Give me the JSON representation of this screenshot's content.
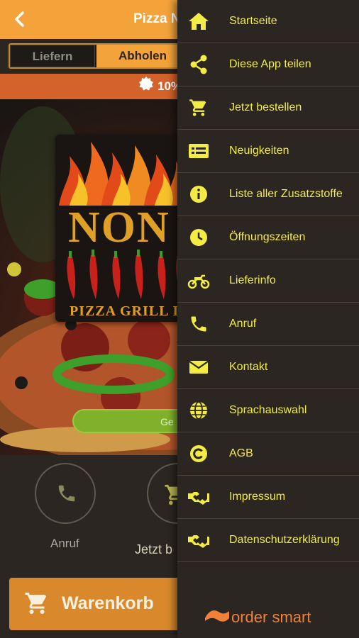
{
  "header": {
    "title": "Pizza N"
  },
  "mode_toggle": {
    "deliver": "Liefern",
    "pickup": "Abholen"
  },
  "promo": {
    "text": "10%"
  },
  "hero": {
    "logo_name": "NON",
    "logo_subtitle": "PIZZA GRILL I",
    "button_label": "Ge"
  },
  "actions": {
    "call_label": "Anruf",
    "order_label": "Jetzt b"
  },
  "cart": {
    "label": "Warenkorb"
  },
  "drawer": {
    "items": [
      {
        "label": "Startseite",
        "icon": "home-icon"
      },
      {
        "label": "Diese App teilen",
        "icon": "share-icon"
      },
      {
        "label": "Jetzt bestellen",
        "icon": "cart-icon"
      },
      {
        "label": "Neuigkeiten",
        "icon": "news-icon"
      },
      {
        "label": "Liste aller Zusatzstoffe",
        "icon": "info-icon"
      },
      {
        "label": "Öffnungszeiten",
        "icon": "clock-icon"
      },
      {
        "label": "Lieferinfo",
        "icon": "motorcycle-icon"
      },
      {
        "label": "Anruf",
        "icon": "phone-icon"
      },
      {
        "label": "Kontakt",
        "icon": "mail-icon"
      },
      {
        "label": "Sprachauswahl",
        "icon": "globe-icon"
      },
      {
        "label": "AGB",
        "icon": "copyright-icon"
      },
      {
        "label": "Impressum",
        "icon": "handshake-icon"
      },
      {
        "label": "Datenschutzerklärung",
        "icon": "handshake-icon"
      }
    ],
    "brand": "order smart"
  },
  "colors": {
    "accent": "#f3a33a",
    "promo": "#d4622b",
    "drawer_bg": "#2b2622",
    "drawer_text": "#f2ec44",
    "green_button": "#7fb22a",
    "brand": "#f0803a"
  }
}
